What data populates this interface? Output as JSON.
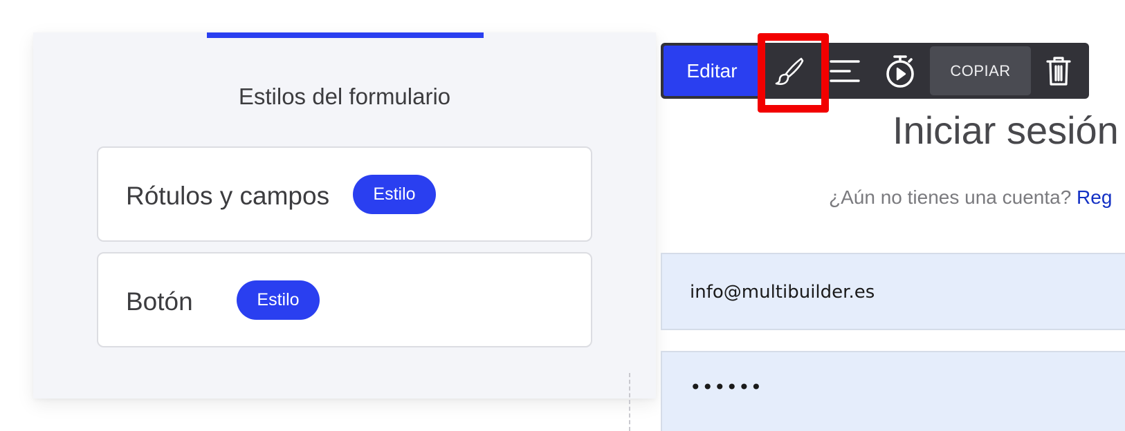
{
  "styles_panel": {
    "title": "Estilos del formulario",
    "items": [
      {
        "label": "Rótulos y campos",
        "button_label": "Estilo"
      },
      {
        "label": "Botón",
        "button_label": "Estilo"
      }
    ]
  },
  "toolbar": {
    "edit_label": "Editar",
    "copy_label": "COPIAR",
    "icons": [
      "paintbrush-icon",
      "align-icon",
      "timer-play-icon",
      "trash-icon"
    ],
    "highlighted": "paintbrush-icon"
  },
  "login": {
    "title": "Iniciar sesión",
    "prompt": "¿Aún no tienes una cuenta?",
    "link_text": "Reg",
    "email_value": "info@multibuilder.es",
    "password_value": "••••••"
  },
  "colors": {
    "accent": "#2a3ff0",
    "highlight": "#f20000",
    "toolbar_bg": "#323238",
    "field_bg": "#e5edfb"
  }
}
